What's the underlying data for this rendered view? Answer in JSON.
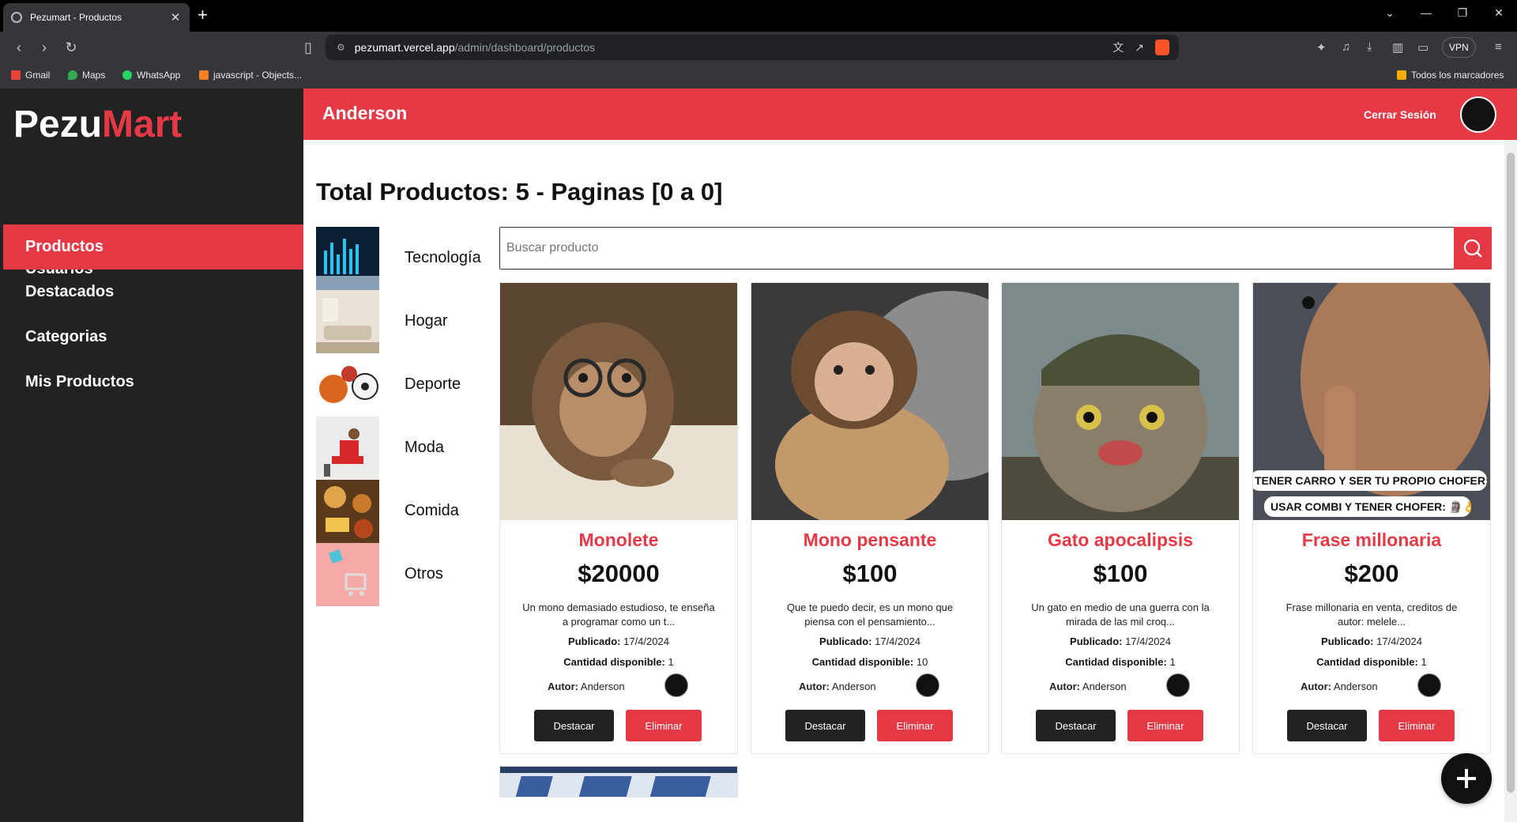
{
  "browser": {
    "tab_title": "Pezumart - Productos",
    "url_host": "pezumart.vercel.app",
    "url_path": "/admin/dashboard/productos",
    "vpn_label": "VPN",
    "bookmarks": [
      "Gmail",
      "Maps",
      "WhatsApp",
      "javascript - Objects...",
      "Todos los marcadores"
    ]
  },
  "app": {
    "logo_main": "Pezu",
    "logo_accent": "Mart",
    "accent_color": "#e63946",
    "sidebar": [
      "Usuarios",
      "Productos",
      "Destacados",
      "Categorias",
      "Mis Productos"
    ],
    "active_item": "Productos",
    "header_user": "Anderson",
    "logout_label": "Cerrar Sesión",
    "page_title": "Total Productos: 5 - Paginas [0 a 0]",
    "categories": [
      "Tecnología",
      "Hogar",
      "Deporte",
      "Moda",
      "Comida",
      "Otros"
    ],
    "search_placeholder": "Buscar producto"
  },
  "products": [
    {
      "name": "Monolete",
      "price": "$20000",
      "description": "Un mono demasiado estudioso, te enseña a programar como un t...",
      "published_label": "Publicado:",
      "published": "17/4/2024",
      "stock_label": "Cantidad disponible:",
      "stock": "1",
      "author_label": "Autor:",
      "author": "Anderson",
      "btn_feature": "Destacar",
      "btn_delete": "Eliminar"
    },
    {
      "name": "Mono pensante",
      "price": "$100",
      "description": "Que te puedo decir, es un mono que piensa con el pensamiento...",
      "published_label": "Publicado:",
      "published": "17/4/2024",
      "stock_label": "Cantidad disponible:",
      "stock": "10",
      "author_label": "Autor:",
      "author": "Anderson",
      "btn_feature": "Destacar",
      "btn_delete": "Eliminar"
    },
    {
      "name": "Gato apocalipsis",
      "price": "$100",
      "description": "Un gato en medio de una guerra con la mirada de las mil croq...",
      "published_label": "Publicado:",
      "published": "17/4/2024",
      "stock_label": "Cantidad disponible:",
      "stock": "1",
      "author_label": "Autor:",
      "author": "Anderson",
      "btn_feature": "Destacar",
      "btn_delete": "Eliminar"
    },
    {
      "name": "Frase millonaria",
      "price": "$200",
      "description": "Frase millonaria en venta, creditos de autor: melele...",
      "published_label": "Publicado:",
      "published": "17/4/2024",
      "stock_label": "Cantidad disponible:",
      "stock": "1",
      "author_label": "Autor:",
      "author": "Anderson",
      "btn_feature": "Destacar",
      "btn_delete": "Eliminar"
    }
  ],
  "product4_meme_lines": [
    "TENER CARRO Y SER TU PROPIO CHOFER: 💀",
    "USAR COMBI Y TENER CHOFER: 🗿👌"
  ]
}
